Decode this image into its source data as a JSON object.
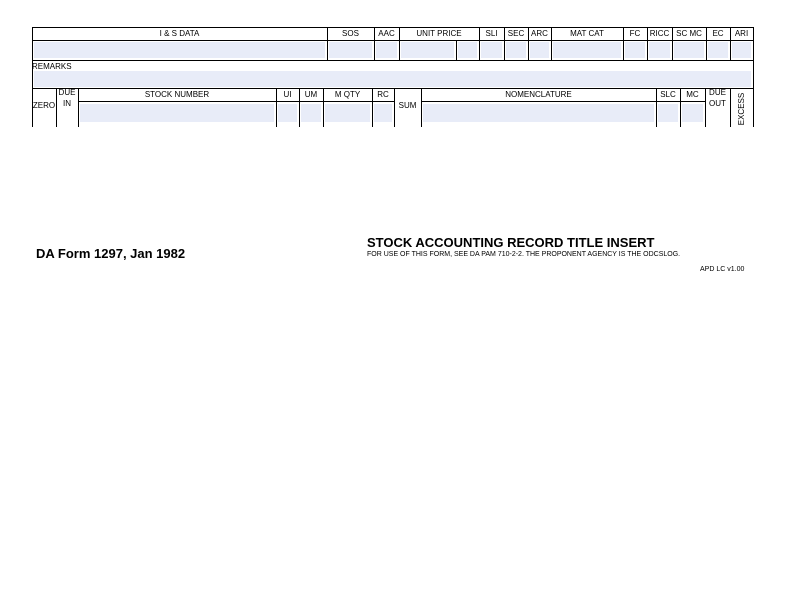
{
  "row1": {
    "headers": [
      "I & S DATA",
      "SOS",
      "AAC",
      "UNIT PRICE",
      "SLI",
      "SEC",
      "ARC",
      "MAT CAT",
      "FC",
      "RICC",
      "SC MC",
      "EC",
      "ARI"
    ]
  },
  "remarks": {
    "label": "REMARKS"
  },
  "row3": {
    "zero": "ZERO",
    "due_in_top": "DUE",
    "due_in_bottom": "IN",
    "headers": [
      "STOCK NUMBER",
      "UI",
      "UM",
      "M QTY",
      "RC"
    ],
    "sum": "SUM",
    "nomenclature": "NOMENCLATURE",
    "slc": "SLC",
    "mc": "MC",
    "due_out_top": "DUE",
    "due_out_bottom": "OUT",
    "excess": "EXCESS"
  },
  "footer": {
    "form_id": "DA Form 1297, Jan 1982",
    "title": "STOCK ACCOUNTING RECORD TITLE INSERT",
    "instructions": "FOR USE OF THIS FORM, SEE DA  PAM 710-2-2.  THE PROPONENT AGENCY IS THE ODCSLOG.",
    "version": "APD LC v1.00"
  },
  "colors": {
    "field_fill": "#e8ecf8",
    "line": "#000000"
  }
}
